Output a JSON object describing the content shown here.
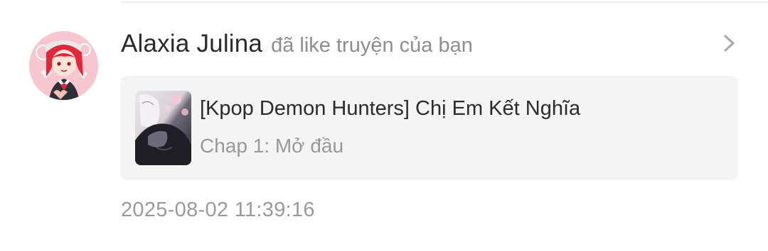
{
  "notification": {
    "user_name": "Alaxia Julina",
    "action": "đã like truyện của bạn",
    "avatar_icon": "user-avatar",
    "chevron_icon": "chevron-right-icon",
    "timestamp": "2025-08-02 11:39:16"
  },
  "story": {
    "title": "[Kpop Demon Hunters] Chị Em Kết Nghĩa",
    "chapter": "Chap 1: Mở đầu",
    "cover_icon": "story-cover-image"
  },
  "colors": {
    "name_text": "#2b2b2b",
    "secondary_text": "#8e8e8e",
    "card_background": "#f4f4f5",
    "divider": "#ececec",
    "avatar_accent": "#e0283a"
  }
}
